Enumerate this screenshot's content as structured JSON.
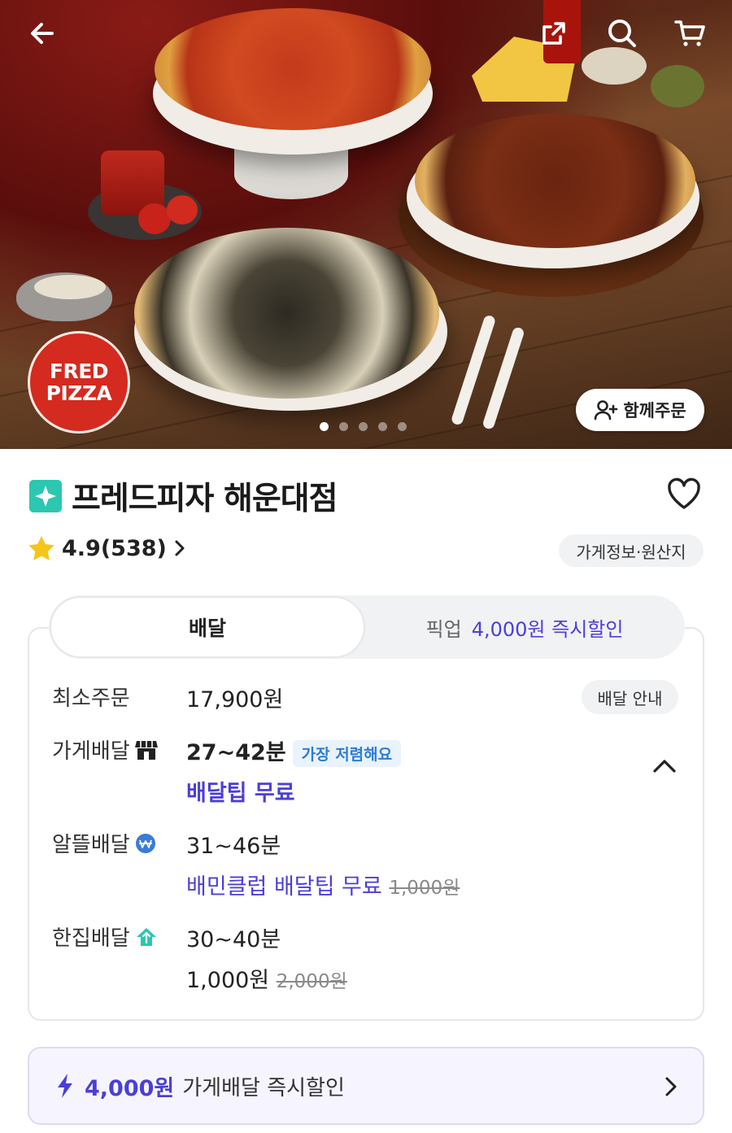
{
  "hero": {
    "logo_line1": "FRED",
    "logo_line2": "PIZZA",
    "carousel_count": 5,
    "carousel_active_index": 0,
    "together_order_label": "함께주문"
  },
  "store": {
    "name": "프레드피자 해운대점",
    "rating": "4.9(538)",
    "info_label": "가게정보·원산지"
  },
  "tabs": {
    "delivery_label": "배달",
    "pickup_label": "픽업",
    "pickup_promo": "4,000원 즉시할인"
  },
  "delivery": {
    "min_order_label": "최소주문",
    "min_order_value": "17,900원",
    "guide_label": "배달 안내",
    "store_delivery": {
      "label": "가게배달",
      "time": "27~42분",
      "tag": "가장 저렴해요",
      "fee_text": "배달팁 무료"
    },
    "saver_delivery": {
      "label": "알뜰배달",
      "time": "31~46분",
      "fee_text": "배민클럽 배달팁 무료",
      "original_fee": "1,000원"
    },
    "single_delivery": {
      "label": "한집배달",
      "time": "30~40분",
      "fee_text": "1,000원",
      "original_fee": "2,000원"
    }
  },
  "promo_bar": {
    "amount": "4,000원",
    "text": "가게배달 즉시할인"
  },
  "colors": {
    "accent_purple": "#4b3fd6",
    "badge_teal": "#2bc7b0",
    "logo_red": "#d42a20",
    "cheap_tag_blue": "#2e7bd6"
  }
}
